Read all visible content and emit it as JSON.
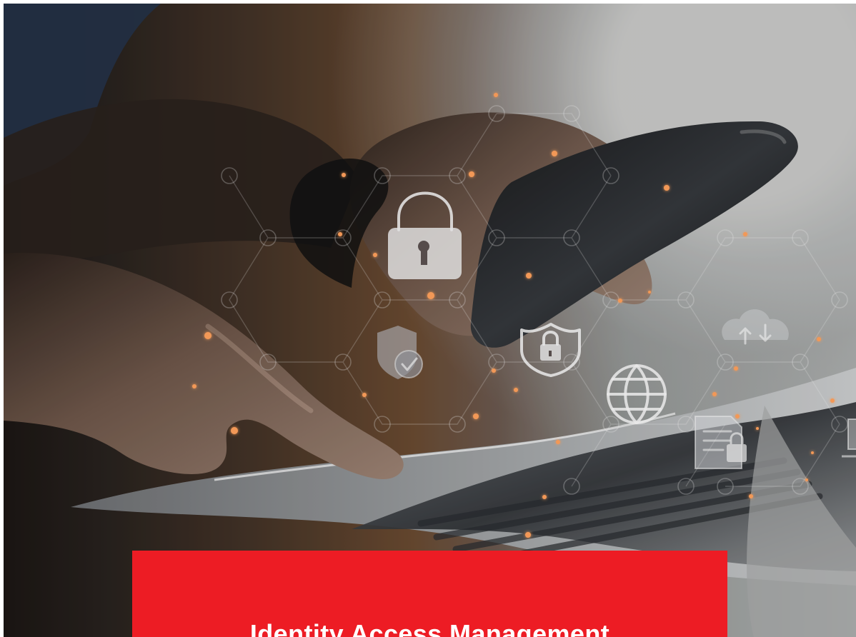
{
  "banner": {
    "title": "Identity Access Management"
  },
  "visual": {
    "accent_color": "#ed1c24",
    "icons": [
      "padlock-icon",
      "shield-check-icon",
      "shield-lock-icon",
      "globe-icon",
      "cloud-sync-icon",
      "document-lock-icon",
      "laptop-icon"
    ]
  }
}
